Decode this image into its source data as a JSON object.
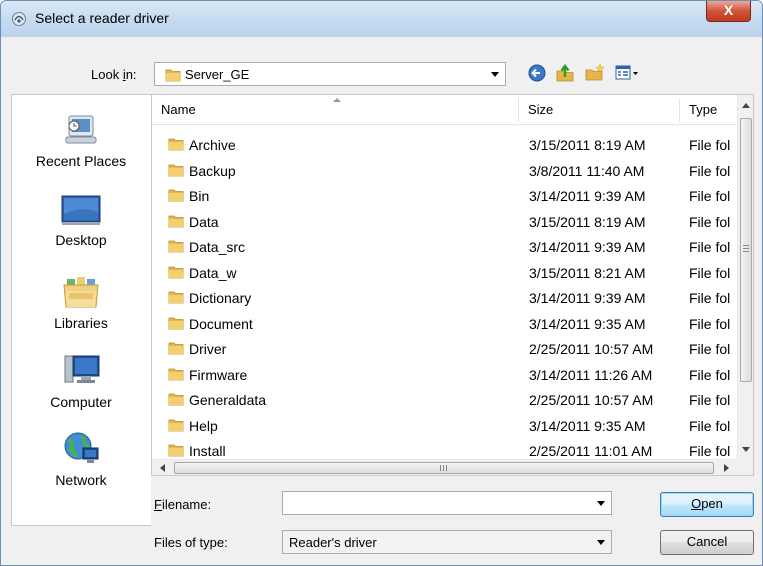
{
  "window": {
    "title": "Select a reader driver",
    "close_label": "X"
  },
  "toolbar": {
    "look_in_label": "Look in:",
    "look_in_value": "Server_GE",
    "icons": [
      "back-icon",
      "up-folder-icon",
      "new-folder-icon",
      "view-menu-icon"
    ]
  },
  "places": [
    {
      "label": "Recent Places",
      "icon": "recent-places-icon"
    },
    {
      "label": "Desktop",
      "icon": "desktop-icon"
    },
    {
      "label": "Libraries",
      "icon": "libraries-icon"
    },
    {
      "label": "Computer",
      "icon": "computer-icon"
    },
    {
      "label": "Network",
      "icon": "network-icon"
    }
  ],
  "list": {
    "columns": [
      "Name",
      "Size",
      "Type"
    ],
    "rows": [
      {
        "name": "Archive",
        "date": "3/15/2011 8:19 AM",
        "type": "File fol"
      },
      {
        "name": "Backup",
        "date": "3/8/2011 11:40 AM",
        "type": "File fol"
      },
      {
        "name": "Bin",
        "date": "3/14/2011 9:39 AM",
        "type": "File fol"
      },
      {
        "name": "Data",
        "date": "3/15/2011 8:19 AM",
        "type": "File fol"
      },
      {
        "name": "Data_src",
        "date": "3/14/2011 9:39 AM",
        "type": "File fol"
      },
      {
        "name": "Data_w",
        "date": "3/15/2011 8:21 AM",
        "type": "File fol"
      },
      {
        "name": "Dictionary",
        "date": "3/14/2011 9:39 AM",
        "type": "File fol"
      },
      {
        "name": "Document",
        "date": "3/14/2011 9:35 AM",
        "type": "File fol"
      },
      {
        "name": "Driver",
        "date": "2/25/2011 10:57 AM",
        "type": "File fol"
      },
      {
        "name": "Firmware",
        "date": "3/14/2011 11:26 AM",
        "type": "File fol"
      },
      {
        "name": "Generaldata",
        "date": "2/25/2011 10:57 AM",
        "type": "File fol"
      },
      {
        "name": "Help",
        "date": "3/14/2011 9:35 AM",
        "type": "File fol"
      },
      {
        "name": "Install",
        "date": "2/25/2011 11:01 AM",
        "type": "File fol"
      }
    ]
  },
  "form": {
    "filename_label": "Filename:",
    "filename_value": "",
    "filetype_label": "Files of type:",
    "filetype_value": "Reader's driver"
  },
  "buttons": {
    "open": "Open",
    "cancel": "Cancel"
  },
  "colors": {
    "folder": "#e8b54a",
    "title_bar": "#c6dbf0",
    "close_button": "#c0391e"
  }
}
